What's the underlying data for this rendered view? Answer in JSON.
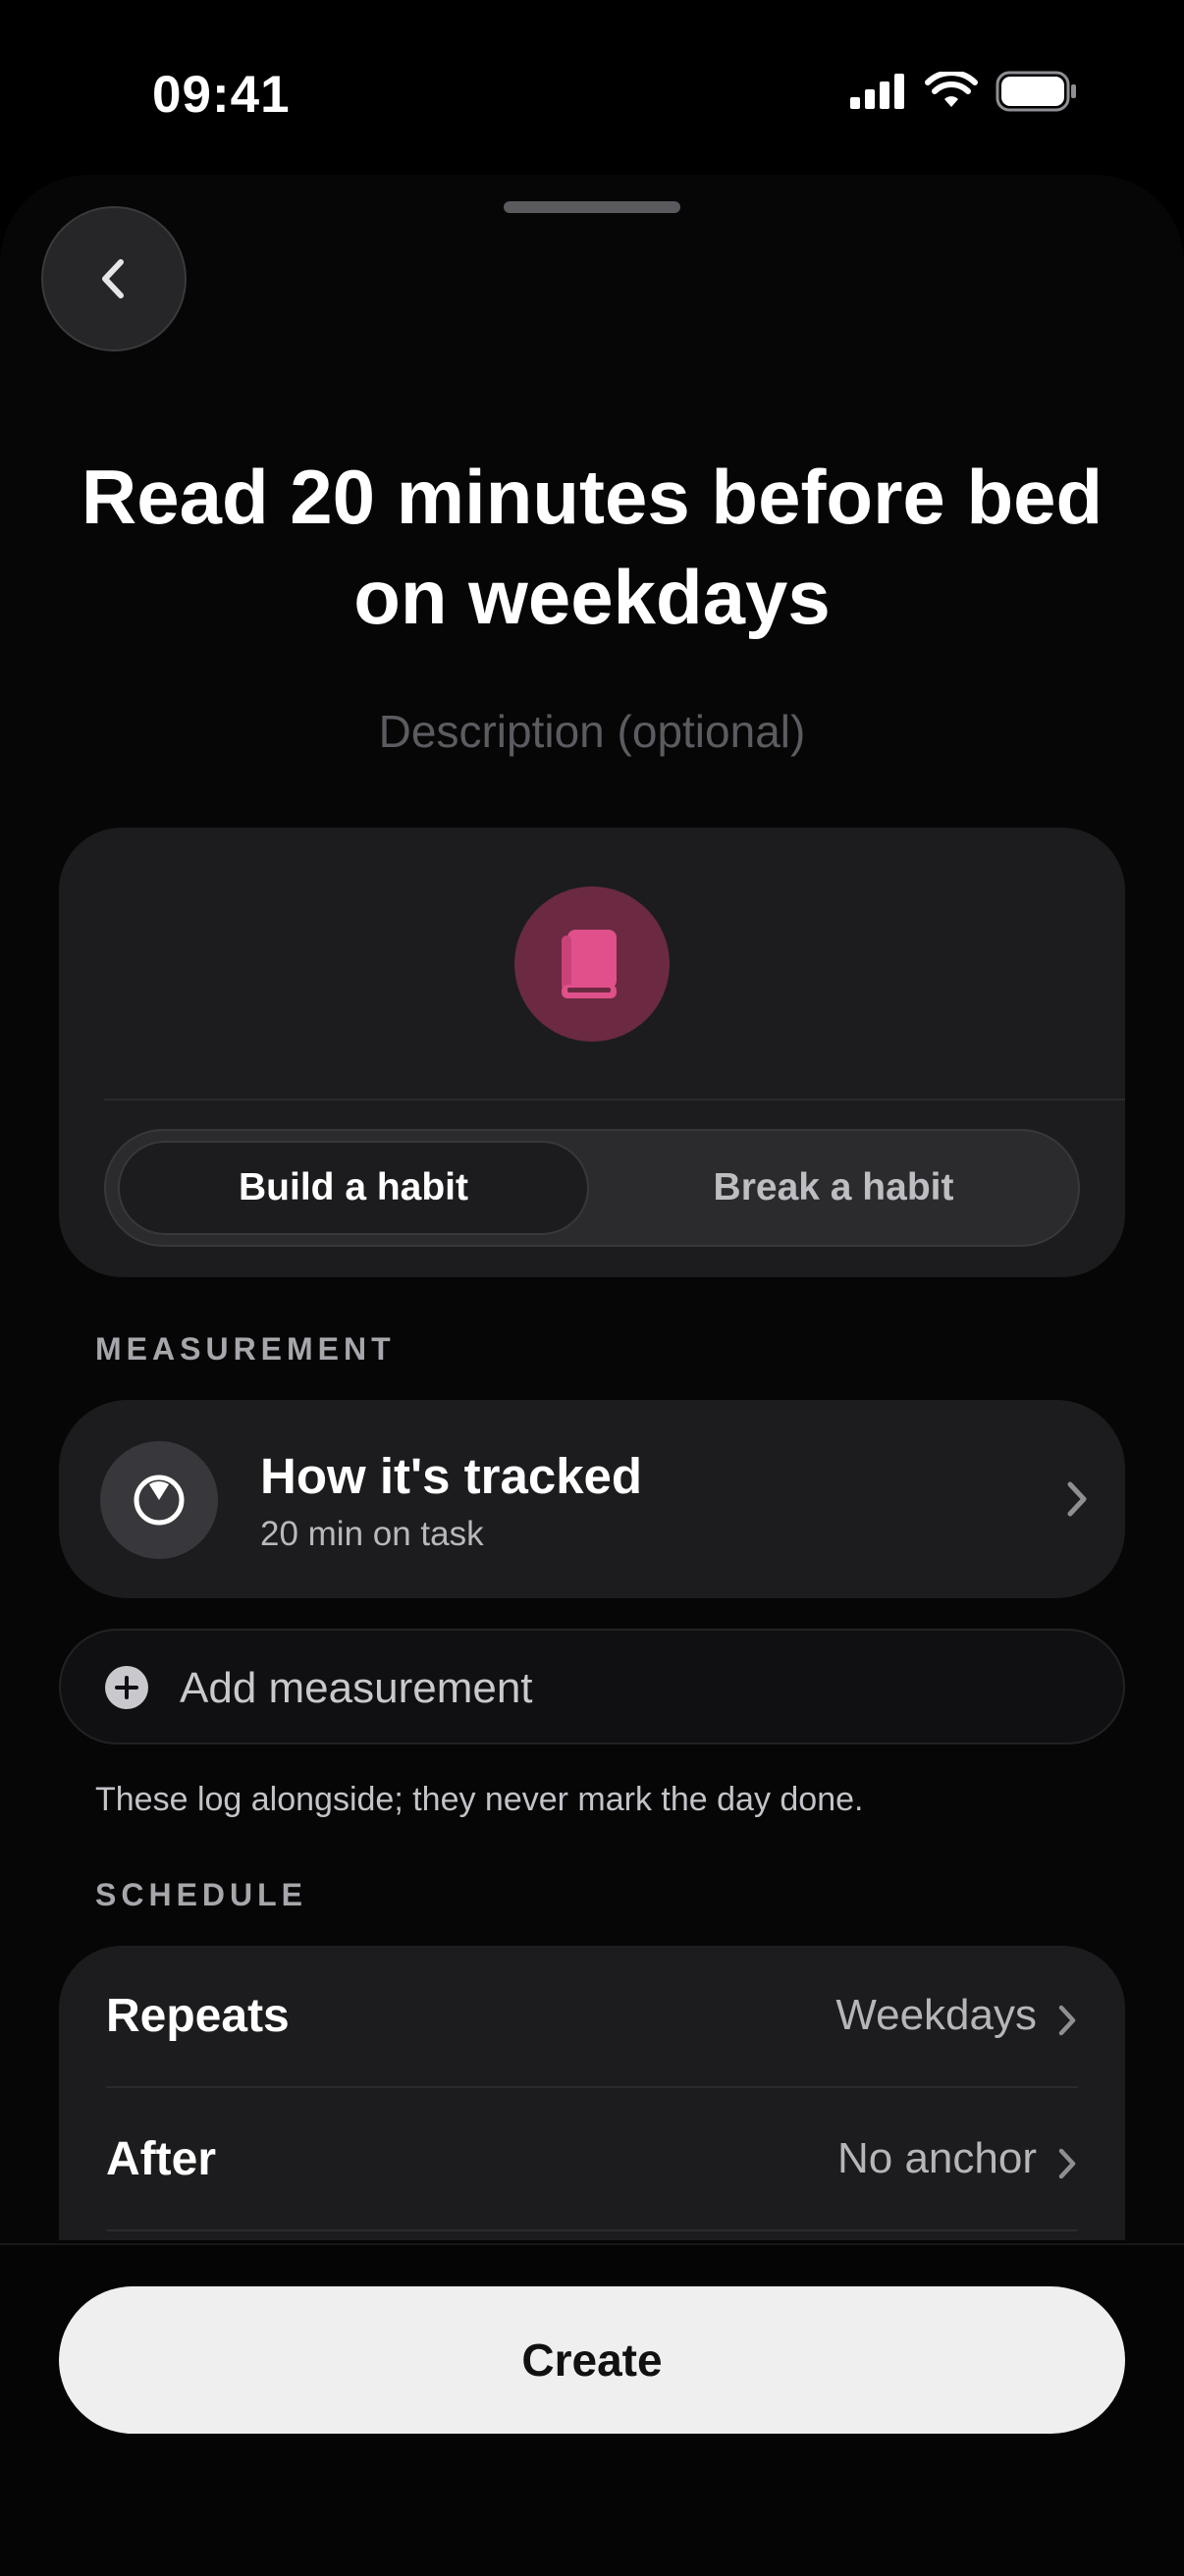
{
  "status_bar": {
    "time": "09:41"
  },
  "header": {
    "title": "Read 20 minutes before bed on weekdays",
    "description_placeholder": "Description (optional)"
  },
  "habit_card": {
    "icon": "book-icon",
    "icon_color": "#e0508a",
    "segment": {
      "options": [
        "Build a habit",
        "Break a habit"
      ],
      "selected": "Build a habit"
    }
  },
  "measurement": {
    "section_label": "MEASUREMENT",
    "tracked": {
      "title": "How it's tracked",
      "subtitle": "20 min on task",
      "icon": "timer-icon"
    },
    "add_label": "Add measurement",
    "helper": "These log alongside; they never mark the day done."
  },
  "schedule": {
    "section_label": "SCHEDULE",
    "rows": [
      {
        "label": "Repeats",
        "value": "Weekdays"
      },
      {
        "label": "After",
        "value": "No anchor"
      }
    ]
  },
  "footer": {
    "create_label": "Create"
  }
}
